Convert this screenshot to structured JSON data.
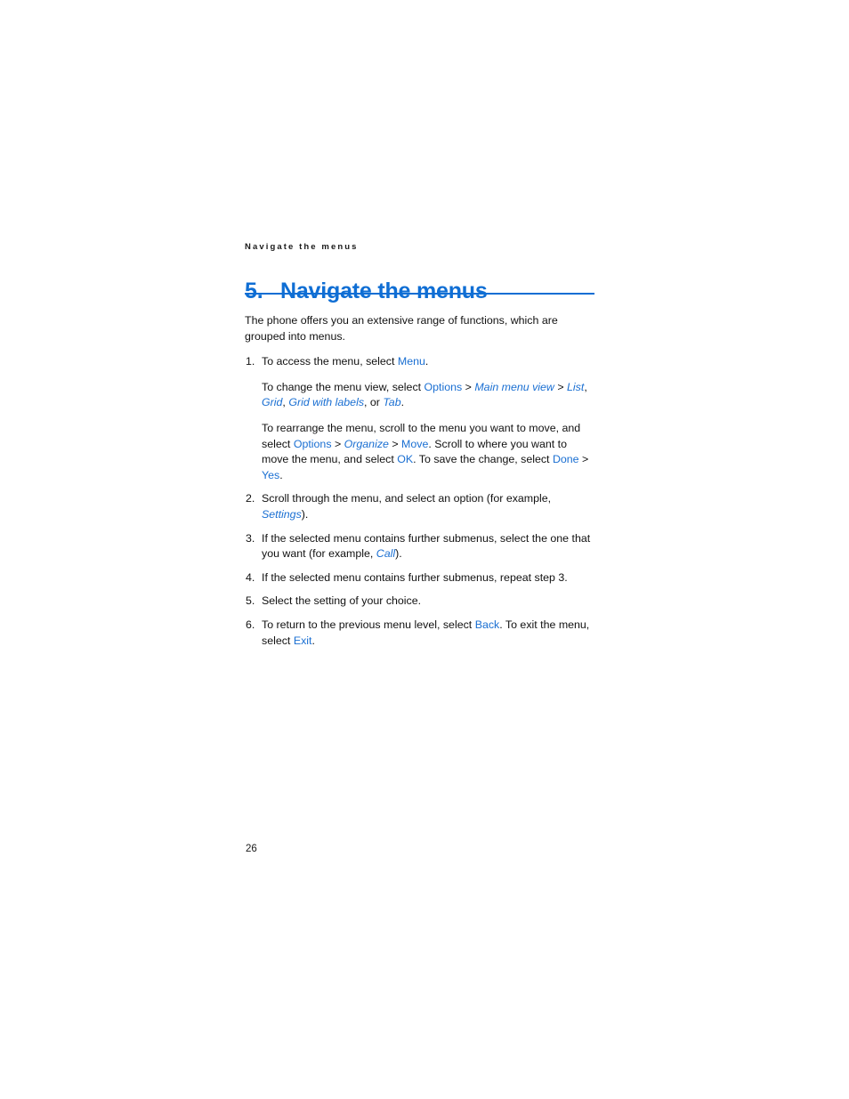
{
  "page": {
    "running_head": "Navigate the menus",
    "folio": "26",
    "accent_color": "#0f6ed4",
    "link_color": "#1a6fd2",
    "text_color": "#111111",
    "background_color": "#ffffff"
  },
  "chapter": {
    "number": "5.",
    "title": "Navigate the menus"
  },
  "intro": "The phone offers you an extensive range of functions, which are grouped into menus.",
  "steps": [
    {
      "number": "1.",
      "paragraphs": [
        {
          "segments": [
            {
              "text": "To access the menu, select ",
              "style": "plain"
            },
            {
              "text": "Menu",
              "style": "ui"
            },
            {
              "text": ".",
              "style": "plain"
            }
          ]
        },
        {
          "segments": [
            {
              "text": "To change the menu view, select ",
              "style": "plain"
            },
            {
              "text": "Options",
              "style": "ui"
            },
            {
              "text": " > ",
              "style": "plain"
            },
            {
              "text": "Main menu view",
              "style": "ui-italic"
            },
            {
              "text": " > ",
              "style": "plain"
            },
            {
              "text": "List",
              "style": "ui-italic"
            },
            {
              "text": ", ",
              "style": "plain"
            },
            {
              "text": "Grid",
              "style": "ui-italic"
            },
            {
              "text": ", ",
              "style": "plain"
            },
            {
              "text": "Grid with labels",
              "style": "ui-italic"
            },
            {
              "text": ", or ",
              "style": "plain"
            },
            {
              "text": "Tab",
              "style": "ui-italic"
            },
            {
              "text": ".",
              "style": "plain"
            }
          ]
        },
        {
          "segments": [
            {
              "text": "To rearrange the menu, scroll to the menu you want to move, and select ",
              "style": "plain"
            },
            {
              "text": "Options",
              "style": "ui"
            },
            {
              "text": " > ",
              "style": "plain"
            },
            {
              "text": "Organize",
              "style": "ui-italic"
            },
            {
              "text": " > ",
              "style": "plain"
            },
            {
              "text": "Move",
              "style": "ui"
            },
            {
              "text": ". Scroll to where you want to move the menu, and select ",
              "style": "plain"
            },
            {
              "text": "OK",
              "style": "ui"
            },
            {
              "text": ". To save the change, select ",
              "style": "plain"
            },
            {
              "text": "Done",
              "style": "ui"
            },
            {
              "text": " > ",
              "style": "plain"
            },
            {
              "text": "Yes",
              "style": "ui"
            },
            {
              "text": ".",
              "style": "plain"
            }
          ]
        }
      ]
    },
    {
      "number": "2.",
      "paragraphs": [
        {
          "segments": [
            {
              "text": "Scroll through the menu, and select an option (for example, ",
              "style": "plain"
            },
            {
              "text": "Settings",
              "style": "ui-italic"
            },
            {
              "text": ").",
              "style": "plain"
            }
          ]
        }
      ]
    },
    {
      "number": "3.",
      "paragraphs": [
        {
          "segments": [
            {
              "text": "If the selected menu contains further submenus, select the one that you want (for example, ",
              "style": "plain"
            },
            {
              "text": "Call",
              "style": "ui-italic"
            },
            {
              "text": ").",
              "style": "plain"
            }
          ]
        }
      ]
    },
    {
      "number": "4.",
      "paragraphs": [
        {
          "segments": [
            {
              "text": "If the selected menu contains further submenus, repeat step 3.",
              "style": "plain"
            }
          ]
        }
      ]
    },
    {
      "number": "5.",
      "paragraphs": [
        {
          "segments": [
            {
              "text": "Select the setting of your choice.",
              "style": "plain"
            }
          ]
        }
      ]
    },
    {
      "number": "6.",
      "paragraphs": [
        {
          "segments": [
            {
              "text": "To return to the previous menu level, select ",
              "style": "plain"
            },
            {
              "text": "Back",
              "style": "ui"
            },
            {
              "text": ". To exit the menu, select ",
              "style": "plain"
            },
            {
              "text": "Exit",
              "style": "ui"
            },
            {
              "text": ".",
              "style": "plain"
            }
          ]
        }
      ]
    }
  ]
}
